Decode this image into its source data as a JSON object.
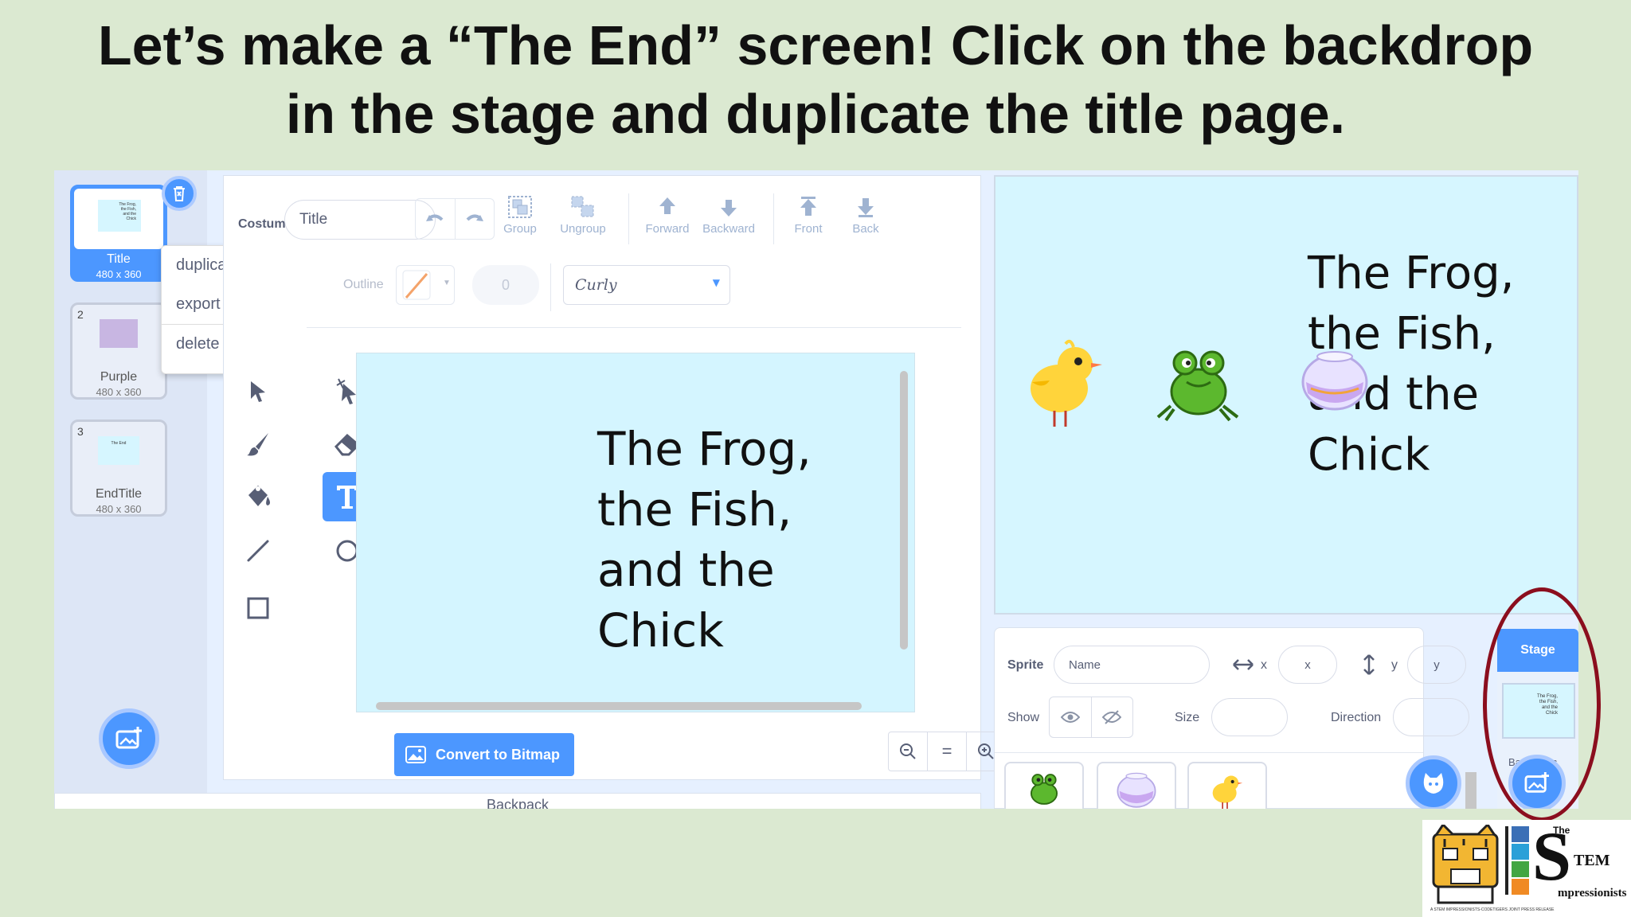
{
  "headline": {
    "line1": "Let’s make a “The End” screen! Click on the backdrop",
    "line2": "in the stage and duplicate the title page."
  },
  "costumes": [
    {
      "num": "1",
      "name": "Title",
      "size": "480 x 360",
      "thumb_lines": [
        "The Frog,",
        "the Fish,",
        "and the",
        "Chick"
      ]
    },
    {
      "num": "2",
      "name": "Purple",
      "size": "480 x 360"
    },
    {
      "num": "3",
      "name": "EndTitle",
      "size": "480 x 360",
      "thumb_text": "The End"
    }
  ],
  "context_menu": [
    "duplicate",
    "export",
    "delete"
  ],
  "editor": {
    "costume_label": "Costume",
    "costume_name": "Title",
    "toolbar": [
      "Group",
      "Ungroup",
      "Forward",
      "Backward",
      "Front",
      "Back"
    ],
    "outline_label": "Outline",
    "outline_value": "0",
    "font_select": "Curly",
    "canvas_text": [
      "The Frog,",
      "the Fish,",
      "and the",
      "Chick"
    ],
    "convert_button": "Convert to Bitmap",
    "zoom": {
      "out": "⊖",
      "reset": "=",
      "in": "⊕"
    }
  },
  "backpack_label": "Backpack",
  "stage": {
    "text_lines": [
      "The Frog,",
      "the Fish,",
      "and the",
      "Chick"
    ]
  },
  "sprite_info": {
    "sprite_label": "Sprite",
    "name_placeholder": "Name",
    "x_label": "x",
    "x_placeholder": "x",
    "y_label": "y",
    "y_placeholder": "y",
    "show_label": "Show",
    "size_label": "Size",
    "direction_label": "Direction"
  },
  "stage_selector": {
    "header": "Stage",
    "backdrops_label": "Backdrops"
  },
  "colors": {
    "accent": "#4c97ff",
    "highlight_oval": "#8b0e1e",
    "background": "#dbe9d1"
  },
  "logo": {
    "lines": [
      "The",
      "TEM",
      "mpressionists"
    ],
    "tagline": "A STEM IMPRESSIONISTS-CODETIGERS JOINT PRESS RELEASE"
  }
}
